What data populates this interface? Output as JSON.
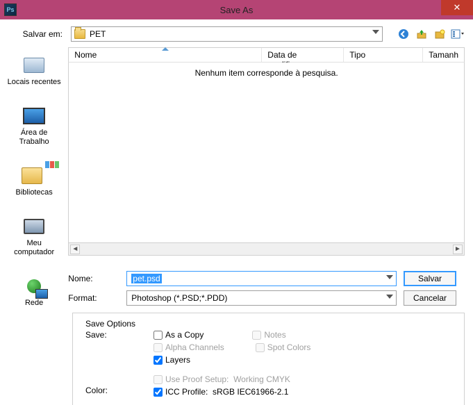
{
  "window": {
    "title": "Save As",
    "app_icon_text": "Ps",
    "close_glyph": "✕"
  },
  "toolbar": {
    "save_in_label": "Salvar em:",
    "folder_name": "PET",
    "nav_icons": {
      "back": "back-icon",
      "up": "up-icon",
      "newfolder": "new-folder-icon",
      "views": "views-icon"
    }
  },
  "sidebar": {
    "items": [
      {
        "label": "Locais recentes",
        "icon": "recent-places-icon"
      },
      {
        "label": "Área de\nTrabalho",
        "icon": "desktop-icon"
      },
      {
        "label": "Bibliotecas",
        "icon": "libraries-icon"
      },
      {
        "label": "Meu\ncomputador",
        "icon": "computer-icon"
      },
      {
        "label": "Rede",
        "icon": "network-icon"
      }
    ]
  },
  "filelist": {
    "columns": {
      "name": "Nome",
      "modified": "Data de modificaç...",
      "type": "Tipo",
      "size": "Tamanh"
    },
    "empty_text": "Nenhum item corresponde à pesquisa."
  },
  "form": {
    "name_label": "Nome:",
    "filename": "pet.psd",
    "format_label": "Format:",
    "format_value": "Photoshop (*.PSD;*.PDD)",
    "save_btn": "Salvar",
    "cancel_btn": "Cancelar"
  },
  "save_options": {
    "title": "Save Options",
    "save_label": "Save:",
    "as_copy": "As a Copy",
    "notes": "Notes",
    "alpha": "Alpha Channels",
    "spot": "Spot Colors",
    "layers": "Layers",
    "color_label": "Color:",
    "proof": "Use Proof Setup:",
    "proof_value": "Working CMYK",
    "icc": "ICC Profile:",
    "icc_value": "sRGB IEC61966-2.1"
  }
}
